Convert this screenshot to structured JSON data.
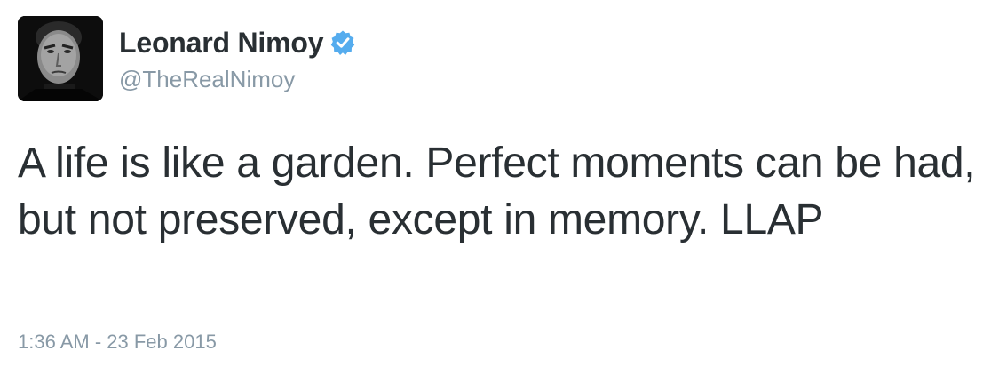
{
  "tweet": {
    "author": {
      "display_name": "Leonard Nimoy",
      "handle": "@TheRealNimoy",
      "verified": true,
      "avatar_icon": "profile-photo",
      "verified_icon": "verified-badge-icon"
    },
    "text": "A life is like a garden. Perfect moments can be had, but not preserved, except in memory.  LLAP",
    "timestamp": "1:36 AM - 23 Feb 2015"
  },
  "colors": {
    "text": "#292f33",
    "secondary": "#8899a6",
    "verified_blue": "#55acee",
    "background": "#ffffff"
  }
}
